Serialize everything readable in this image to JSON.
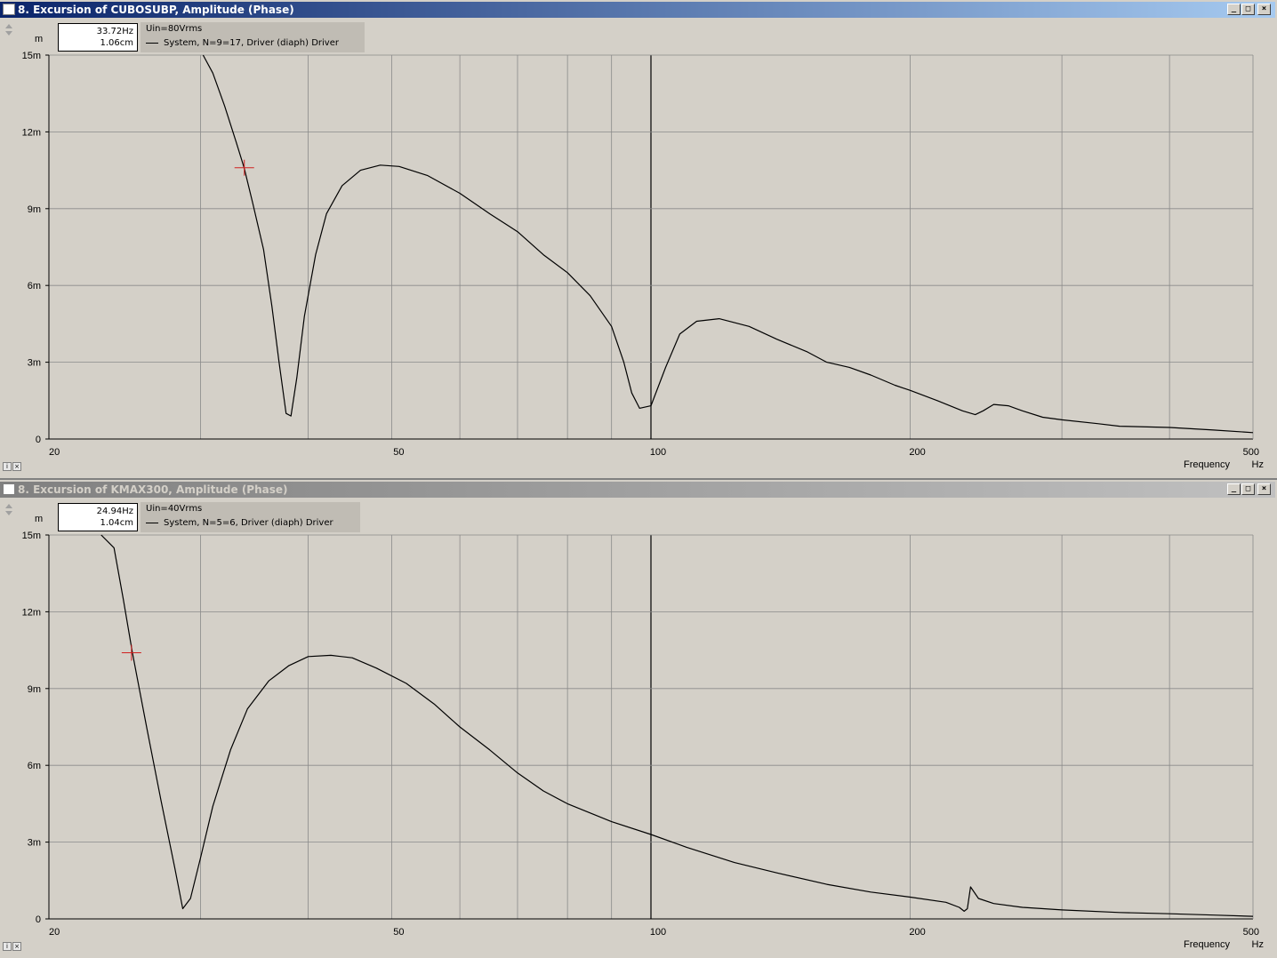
{
  "windows": [
    {
      "title": "8. Excursion of CUBOSUBP, Amplitude (Phase)",
      "active": true,
      "cursor_readout": {
        "frequency": "33.72Hz",
        "value": "1.06cm"
      },
      "cursor": {
        "f": 33.72,
        "y": 10.6
      },
      "legend_header": "Uin=80Vrms",
      "legend_series": "System, N=9=17, Driver (diaph) Driver",
      "y_unit": "m",
      "x_label": "Frequency",
      "x_unit": "Hz",
      "chart_data": {
        "type": "line",
        "title": "8. Excursion of CUBOSUBP, Amplitude (Phase)",
        "xlabel": "Frequency",
        "x_unit": "Hz",
        "x_scale": "log",
        "xlim": [
          20,
          500
        ],
        "x_ticks": [
          20,
          50,
          100,
          200,
          500
        ],
        "ylabel": "m",
        "ylim": [
          0,
          15
        ],
        "y_ticks": [
          "0",
          "3m",
          "6m",
          "9m",
          "12m",
          "15m"
        ],
        "y_tick_values": [
          0,
          3,
          6,
          9,
          12,
          15
        ],
        "grid": true,
        "series": [
          {
            "name": "System, N=9=17, Driver (diaph) Driver",
            "x": [
              30.2,
              31.0,
              32.0,
              33.0,
              33.7,
              34.5,
              35.5,
              36.3,
              37.0,
              37.7,
              38.2,
              38.8,
              39.6,
              40.8,
              42.0,
              43.8,
              46.0,
              48.5,
              51.0,
              55.0,
              60.0,
              65.0,
              70.0,
              75.0,
              80.0,
              85.0,
              90.0,
              93.0,
              95.0,
              97.0,
              100.0,
              104.0,
              108.0,
              113.0,
              120.0,
              130.0,
              140.0,
              152.0,
              160.0,
              170.0,
              180.0,
              192.0,
              200.0,
              215.0,
              230.0,
              238.0,
              243.0,
              250.0,
              260.0,
              270.0,
              285.0,
              300.0,
              330.0,
              350.0,
              400.0,
              450.0,
              500.0
            ],
            "y": [
              15.0,
              14.3,
              13.0,
              11.6,
              10.6,
              9.2,
              7.4,
              5.2,
              3.0,
              1.0,
              0.9,
              2.4,
              4.8,
              7.2,
              8.8,
              9.9,
              10.5,
              10.7,
              10.65,
              10.3,
              9.6,
              8.8,
              8.1,
              7.2,
              6.5,
              5.6,
              4.4,
              3.0,
              1.8,
              1.2,
              1.3,
              2.8,
              4.1,
              4.6,
              4.7,
              4.4,
              3.9,
              3.4,
              3.0,
              2.8,
              2.5,
              2.1,
              1.9,
              1.5,
              1.1,
              0.95,
              1.1,
              1.35,
              1.3,
              1.1,
              0.85,
              0.75,
              0.6,
              0.5,
              0.45,
              0.35,
              0.25
            ]
          }
        ]
      }
    },
    {
      "title": "8. Excursion of KMAX300, Amplitude (Phase)",
      "active": false,
      "cursor_readout": {
        "frequency": "24.94Hz",
        "value": "1.04cm"
      },
      "cursor": {
        "f": 24.94,
        "y": 10.4
      },
      "legend_header": "Uin=40Vrms",
      "legend_series": "System, N=5=6, Driver (diaph) Driver",
      "y_unit": "m",
      "x_label": "Frequency",
      "x_unit": "Hz",
      "chart_data": {
        "type": "line",
        "title": "8. Excursion of KMAX300, Amplitude (Phase)",
        "xlabel": "Frequency",
        "x_unit": "Hz",
        "x_scale": "log",
        "xlim": [
          20,
          500
        ],
        "x_ticks": [
          20,
          50,
          100,
          200,
          500
        ],
        "ylabel": "m",
        "ylim": [
          0,
          15
        ],
        "y_ticks": [
          "0",
          "3m",
          "6m",
          "9m",
          "12m",
          "15m"
        ],
        "y_tick_values": [
          0,
          3,
          6,
          9,
          12,
          15
        ],
        "grid": true,
        "series": [
          {
            "name": "System, N=5=6, Driver (diaph) Driver",
            "x": [
              23.0,
              23.8,
              24.4,
              25.0,
              26.0,
              27.0,
              28.0,
              28.6,
              29.2,
              30.0,
              31.0,
              32.5,
              34.0,
              36.0,
              38.0,
              40.0,
              42.5,
              45.0,
              48.0,
              52.0,
              56.0,
              60.0,
              65.0,
              70.0,
              75.0,
              80.0,
              90.0,
              100.0,
              110.0,
              125.0,
              140.0,
              160.0,
              180.0,
              200.0,
              220.0,
              228.0,
              231.0,
              233.0,
              235.0,
              240.0,
              250.0,
              270.0,
              300.0,
              350.0,
              400.0,
              450.0,
              500.0
            ],
            "y": [
              15.0,
              14.5,
              12.5,
              10.4,
              7.4,
              4.6,
              2.0,
              0.4,
              0.8,
              2.4,
              4.4,
              6.6,
              8.2,
              9.3,
              9.9,
              10.25,
              10.3,
              10.2,
              9.8,
              9.2,
              8.4,
              7.5,
              6.6,
              5.7,
              5.0,
              4.5,
              3.8,
              3.3,
              2.8,
              2.2,
              1.8,
              1.35,
              1.05,
              0.85,
              0.65,
              0.45,
              0.3,
              0.4,
              1.25,
              0.8,
              0.6,
              0.45,
              0.35,
              0.25,
              0.2,
              0.15,
              0.1
            ]
          }
        ]
      }
    }
  ]
}
